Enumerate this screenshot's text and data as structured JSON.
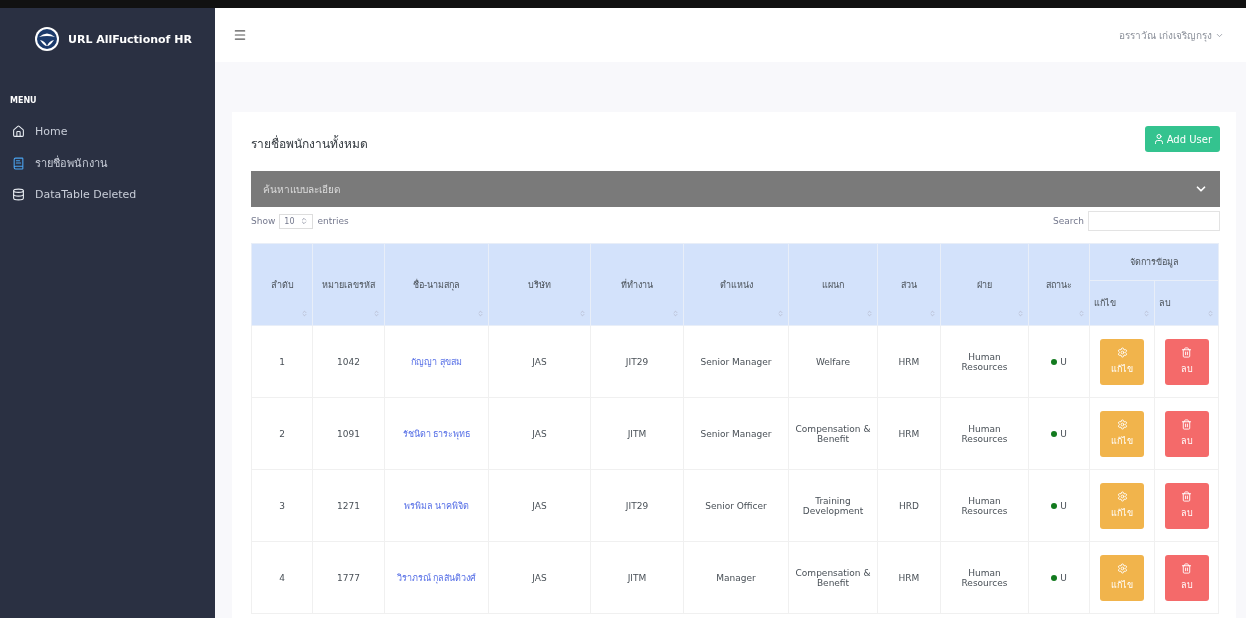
{
  "brand": {
    "name": "URL AllFuctionof HR"
  },
  "sidebar": {
    "heading": "MENU",
    "items": [
      {
        "label": "Home",
        "selected": false
      },
      {
        "label": "รายชื่อพนักงาน",
        "selected": true
      },
      {
        "label": "DataTable Deleted",
        "selected": false
      }
    ]
  },
  "topbar": {
    "user": "อรราวัณ เก่งเจริญกรุง"
  },
  "card": {
    "title": "รายชื่อพนักงานทั้งหมด",
    "add_button": "Add User",
    "filter_panel": {
      "label": "ค้นหาแบบละเอียด",
      "expanded": false
    },
    "show_label": "Show",
    "page_size": "10",
    "entries_label": "entries",
    "search_label": "Search"
  },
  "table": {
    "columns": [
      "ลำดับ",
      "หมายเลขรหัส",
      "ชื่อ-นามสกุล",
      "บริษัท",
      "ที่ทำงาน",
      "ตำแหน่ง",
      "แผนก",
      "ส่วน",
      "ฝ่าย",
      "สถานะ"
    ],
    "group_header": "จัดการข้อมูล",
    "action_columns": [
      "แก้ไข",
      "ลบ"
    ],
    "rows": [
      {
        "no": "1",
        "code": "1042",
        "name": "กัญญา สุขสม",
        "company": "JAS",
        "workplace": "JIT29",
        "position": "Senior Manager",
        "department": "Welfare",
        "section": "HRM",
        "division": "Human Resources",
        "status": "U",
        "edit": "แก้ไข",
        "delete": "ลบ"
      },
      {
        "no": "2",
        "code": "1091",
        "name": "รัชนิดา ธาระพุทธ",
        "company": "JAS",
        "workplace": "JITM",
        "position": "Senior Manager",
        "department": "Compensation & Benefit",
        "section": "HRM",
        "division": "Human Resources",
        "status": "U",
        "edit": "แก้ไข",
        "delete": "ลบ"
      },
      {
        "no": "3",
        "code": "1271",
        "name": "พรพิมล นาคพิจิต",
        "company": "JAS",
        "workplace": "JIT29",
        "position": "Senior Officer",
        "department": "Training Development",
        "section": "HRD",
        "division": "Human Resources",
        "status": "U",
        "edit": "แก้ไข",
        "delete": "ลบ"
      },
      {
        "no": "4",
        "code": "1777",
        "name": "วิราภรณ์ กุลสันติวงศ์",
        "company": "JAS",
        "workplace": "JITM",
        "position": "Manager",
        "department": "Compensation & Benefit",
        "section": "HRM",
        "division": "Human Resources",
        "status": "U",
        "edit": "แก้ไข",
        "delete": "ลบ"
      }
    ]
  }
}
